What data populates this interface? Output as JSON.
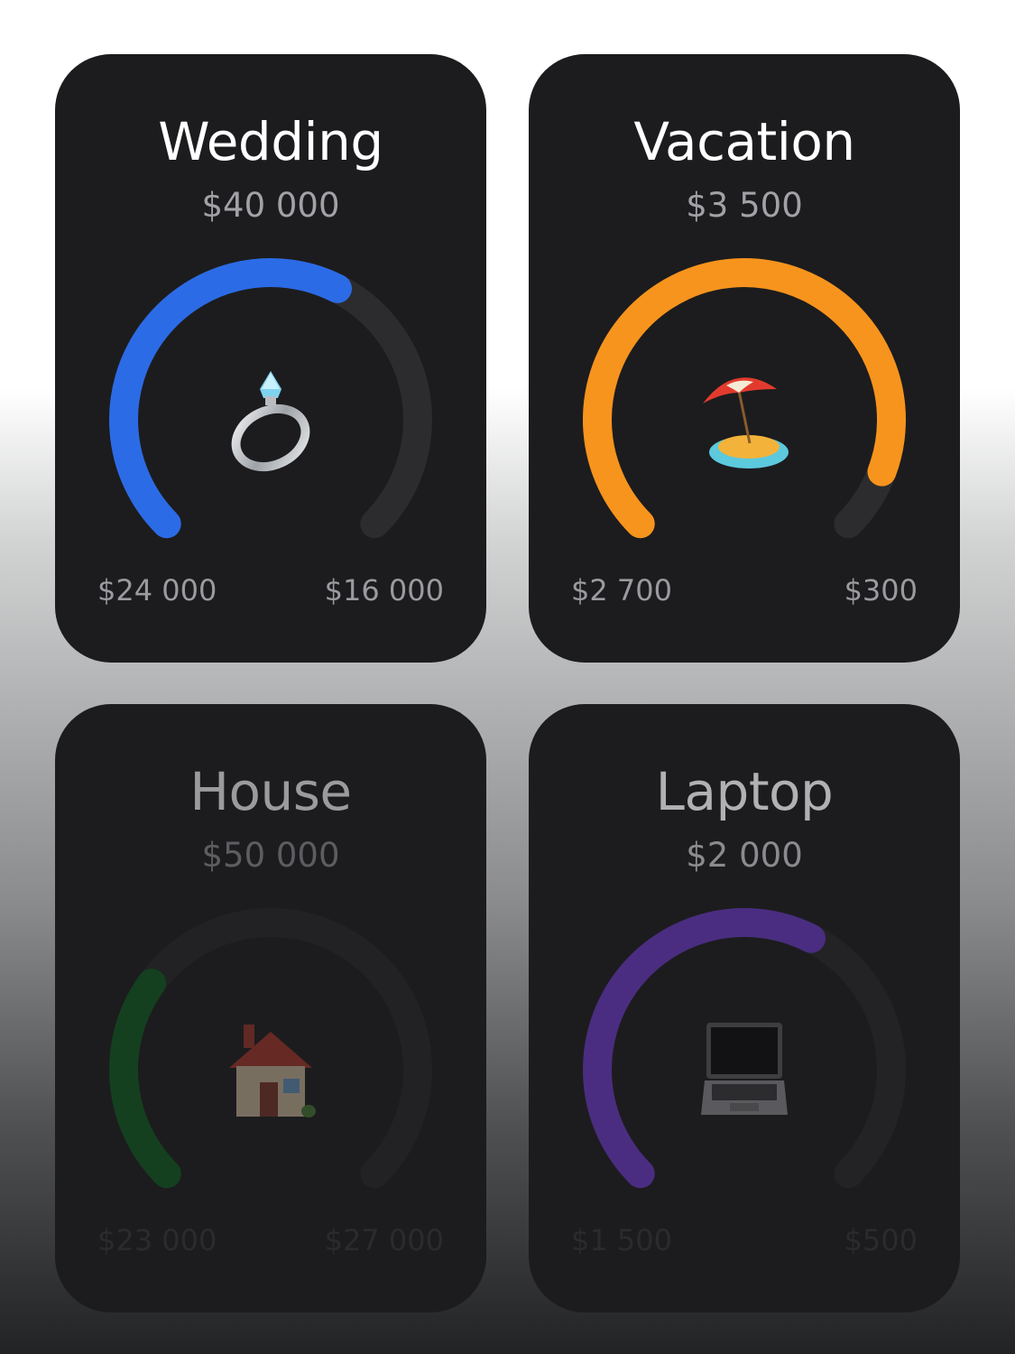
{
  "goals": [
    {
      "title": "Wedding",
      "amount": "$40 000",
      "saved": "$24 000",
      "remaining": "$16 000",
      "progress": 0.6,
      "color": "#2c6be6",
      "icon": "ring-icon"
    },
    {
      "title": "Vacation",
      "amount": "$3 500",
      "saved": "$2 700",
      "remaining": "$300",
      "progress": 0.91,
      "color": "#f7941d",
      "icon": "beach-umbrella-icon"
    },
    {
      "title": "House",
      "amount": "$50 000",
      "saved": "$23 000",
      "remaining": "$27 000",
      "progress": 0.3,
      "color": "#14401f",
      "icon": "house-icon"
    },
    {
      "title": "Laptop",
      "amount": "$2 000",
      "saved": "$1 500",
      "remaining": "$500",
      "progress": 0.6,
      "color": "#4a2d80",
      "icon": "laptop-icon"
    }
  ],
  "track_colors": [
    "#2c2c2e",
    "#2c2c2e",
    "#222224",
    "#232325"
  ]
}
